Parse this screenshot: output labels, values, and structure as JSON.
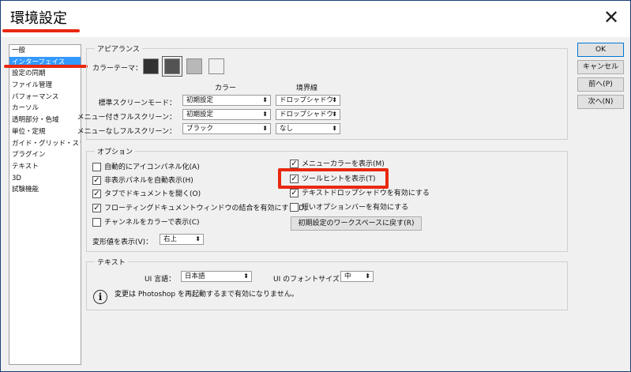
{
  "window": {
    "title": "環境設定",
    "close_glyph": "✕"
  },
  "sidebar": {
    "items": [
      {
        "label": "一般",
        "selected": false
      },
      {
        "label": "インターフェイス",
        "selected": true
      },
      {
        "label": "設定の同期",
        "selected": false
      },
      {
        "label": "ファイル管理",
        "selected": false
      },
      {
        "label": "パフォーマンス",
        "selected": false
      },
      {
        "label": "カーソル",
        "selected": false
      },
      {
        "label": "透明部分・色域",
        "selected": false
      },
      {
        "label": "単位・定規",
        "selected": false
      },
      {
        "label": "ガイド・グリッド・スライス",
        "selected": false
      },
      {
        "label": "プラグイン",
        "selected": false
      },
      {
        "label": "テキスト",
        "selected": false
      },
      {
        "label": "3D",
        "selected": false
      },
      {
        "label": "試験機能",
        "selected": false
      }
    ]
  },
  "appearance": {
    "group_title": "アピアランス",
    "color_theme_label": "カラーテーマ：",
    "themes": [
      {
        "color": "#323232",
        "selected": false
      },
      {
        "color": "#535353",
        "selected": true
      },
      {
        "color": "#b8b8b8",
        "selected": false
      },
      {
        "color": "#f0f0f0",
        "selected": false
      }
    ],
    "col_color": "カラー",
    "col_border": "境界線",
    "rows": [
      {
        "label": "標準スクリーンモード：",
        "color": "初期設定",
        "border": "ドロップシャドウ"
      },
      {
        "label": "メニュー付きフルスクリーン：",
        "color": "初期設定",
        "border": "ドロップシャドウ"
      },
      {
        "label": "メニューなしフルスクリーン：",
        "color": "ブラック",
        "border": "なし"
      }
    ]
  },
  "options": {
    "group_title": "オプション",
    "left": [
      {
        "label": "自動的にアイコンパネル化(A)",
        "checked": false
      },
      {
        "label": "非表示パネルを自動表示(H)",
        "checked": true
      },
      {
        "label": "タブでドキュメントを開く(O)",
        "checked": true
      },
      {
        "label": "フローティングドキュメントウィンドウの結合を有効にする(D)",
        "checked": true
      },
      {
        "label": "チャンネルをカラーで表示(C)",
        "checked": false
      }
    ],
    "right": [
      {
        "label": "メニューカラーを表示(M)",
        "checked": true
      },
      {
        "label": "ツールヒントを表示(T)",
        "checked": true
      },
      {
        "label": "テキストドロップシャドウを有効にする",
        "checked": true
      },
      {
        "label": "短いオプションバーを有効にする",
        "checked": false
      }
    ],
    "reset_workspace_button": "初期設定のワークスペースに戻す(R)",
    "transform_label": "変形値を表示(V)：",
    "transform_value": "右上"
  },
  "text_group": {
    "group_title": "テキスト",
    "ui_language_label": "UI 言語：",
    "ui_language_value": "日本語",
    "ui_font_size_label": "UI のフォントサイズ：",
    "ui_font_size_value": "中",
    "info_text": "変更は Photoshop を再起動するまで有効になりません。"
  },
  "buttons": {
    "ok": "OK",
    "cancel": "キャンセル",
    "prev": "前へ(P)",
    "next": "次へ(N)"
  },
  "highlight_color": "#e8280f",
  "accent_color": "#3399ff",
  "check_glyph": "✓",
  "dropdown_glyph": "⬍"
}
